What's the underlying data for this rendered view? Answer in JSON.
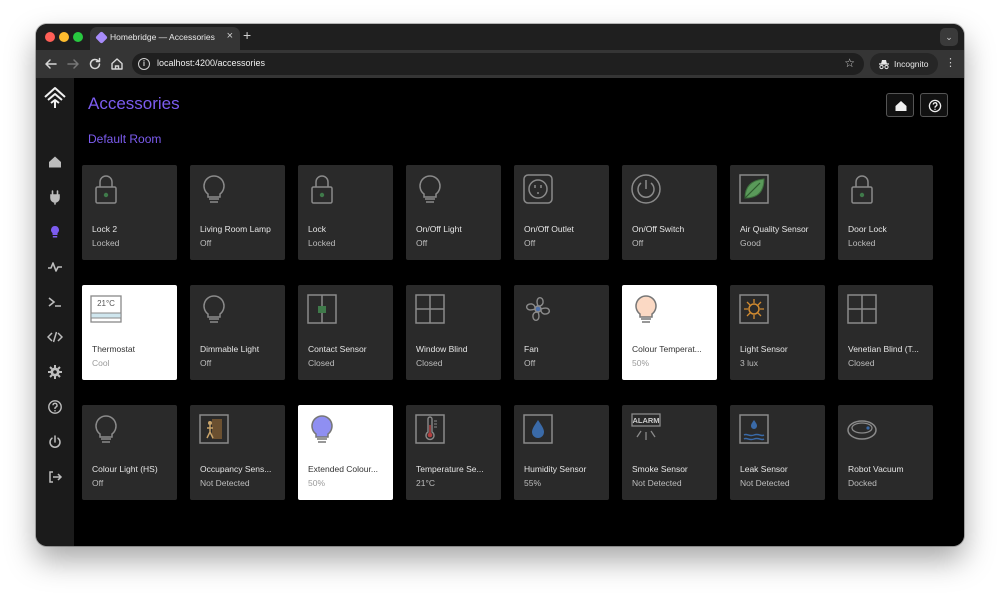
{
  "browser": {
    "tab_title": "Homebridge — Accessories",
    "tab_close": "×",
    "new_tab": "+",
    "url": "localhost:4200/accessories",
    "profile_label": "Incognito"
  },
  "sidebar": {
    "items": [
      {
        "icon": "home-icon"
      },
      {
        "icon": "plug-icon"
      },
      {
        "icon": "lightbulb-icon",
        "active": true
      },
      {
        "icon": "pulse-icon"
      },
      {
        "icon": "terminal-icon"
      },
      {
        "icon": "code-icon"
      },
      {
        "icon": "gear-icon"
      },
      {
        "icon": "help-icon"
      },
      {
        "icon": "power-icon"
      },
      {
        "icon": "logout-icon"
      }
    ]
  },
  "page": {
    "title": "Accessories",
    "room": "Default Room"
  },
  "colors": {
    "accent": "#7c5cf0",
    "tile_off": "#2a2a2a",
    "tile_on": "#ffffff",
    "sidebar": "#1b1b1b"
  },
  "tiles": [
    {
      "name": "Lock 2",
      "status": "Locked",
      "icon": "lock-icon",
      "on": false
    },
    {
      "name": "Living Room Lamp",
      "status": "Off",
      "icon": "lightbulb-icon",
      "on": false
    },
    {
      "name": "Lock",
      "status": "Locked",
      "icon": "lock-icon",
      "on": false
    },
    {
      "name": "On/Off Light",
      "status": "Off",
      "icon": "lightbulb-icon",
      "on": false
    },
    {
      "name": "On/Off Outlet",
      "status": "Off",
      "icon": "outlet-icon",
      "on": false
    },
    {
      "name": "On/Off Switch",
      "status": "Off",
      "icon": "power-switch-icon",
      "on": false
    },
    {
      "name": "Air Quality Sensor",
      "status": "Good",
      "icon": "leaf-icon",
      "on": false
    },
    {
      "name": "Door Lock",
      "status": "Locked",
      "icon": "lock-icon",
      "on": false
    },
    {
      "name": "Thermostat",
      "status": "Cool",
      "icon": "thermostat-icon",
      "on": true,
      "reading": "21°C"
    },
    {
      "name": "Dimmable Light",
      "status": "Off",
      "icon": "lightbulb-icon",
      "on": false
    },
    {
      "name": "Contact Sensor",
      "status": "Closed",
      "icon": "contact-sensor-icon",
      "on": false
    },
    {
      "name": "Window Blind",
      "status": "Closed",
      "icon": "window-icon",
      "on": false
    },
    {
      "name": "Fan",
      "status": "Off",
      "icon": "fan-icon",
      "on": false
    },
    {
      "name": "Colour Temperat...",
      "status": "50%",
      "icon": "lightbulb-warm-icon",
      "on": true
    },
    {
      "name": "Light Sensor",
      "status": "3 lux",
      "icon": "sun-sensor-icon",
      "on": false
    },
    {
      "name": "Venetian Blind (T...",
      "status": "Closed",
      "icon": "window-icon",
      "on": false
    },
    {
      "name": "Colour Light (HS)",
      "status": "Off",
      "icon": "lightbulb-icon",
      "on": false
    },
    {
      "name": "Occupancy Sens...",
      "status": "Not Detected",
      "icon": "occupancy-icon",
      "on": false
    },
    {
      "name": "Extended Colour...",
      "status": "50%",
      "icon": "lightbulb-purple-icon",
      "on": true
    },
    {
      "name": "Temperature Se...",
      "status": "21°C",
      "icon": "thermometer-icon",
      "on": false
    },
    {
      "name": "Humidity Sensor",
      "status": "55%",
      "icon": "droplet-icon",
      "on": false
    },
    {
      "name": "Smoke Sensor",
      "status": "Not Detected",
      "icon": "alarm-icon",
      "on": false,
      "alarm_text": "ALARM"
    },
    {
      "name": "Leak Sensor",
      "status": "Not Detected",
      "icon": "leak-icon",
      "on": false
    },
    {
      "name": "Robot Vacuum",
      "status": "Docked",
      "icon": "robot-vacuum-icon",
      "on": false
    }
  ]
}
